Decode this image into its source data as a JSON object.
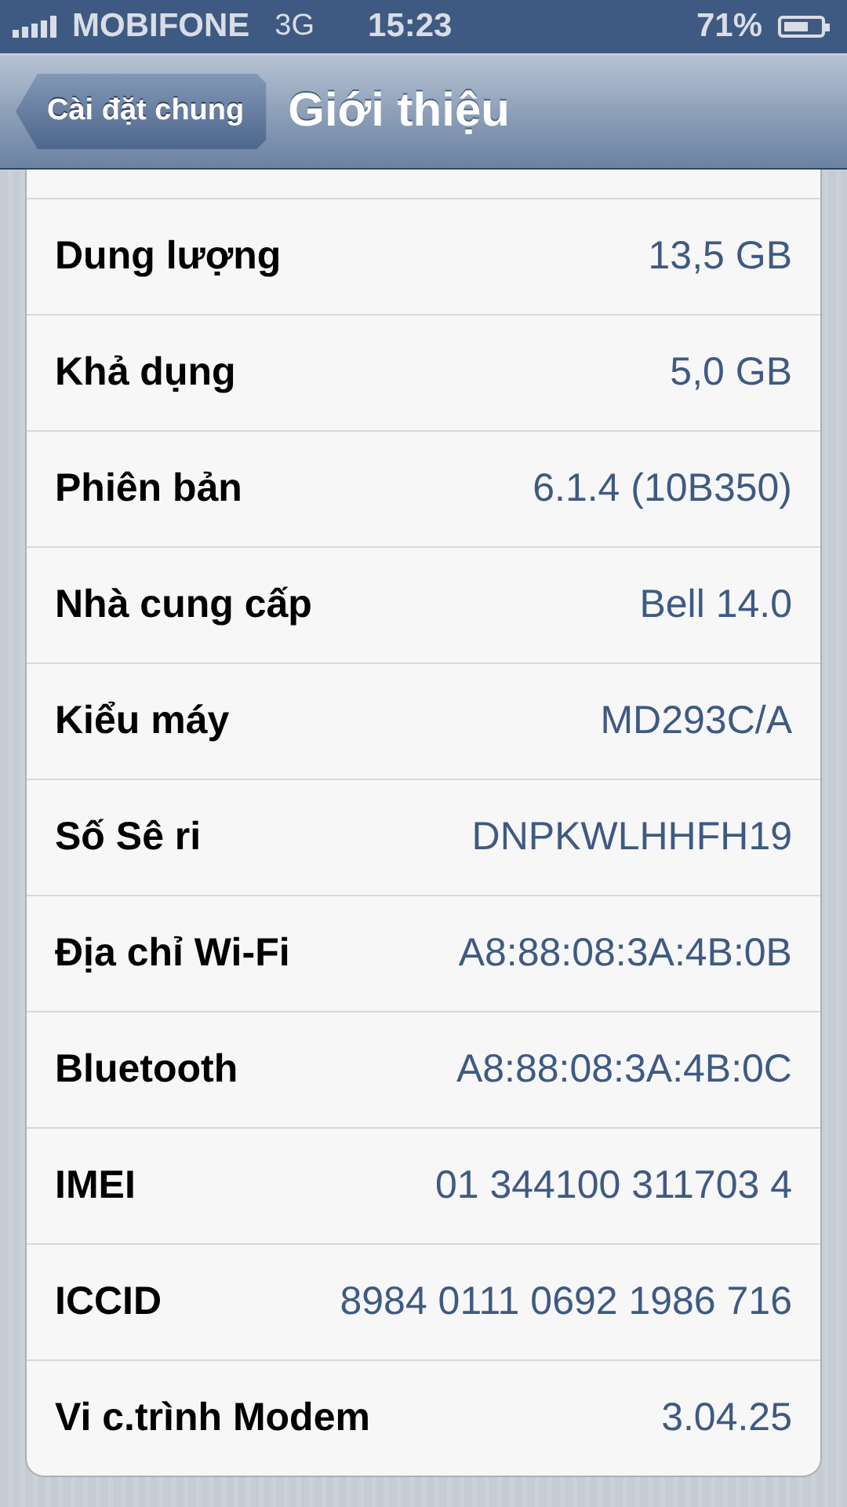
{
  "status_bar": {
    "carrier": "MOBIFONE",
    "network": "3G",
    "time": "15:23",
    "battery": "71%"
  },
  "nav_bar": {
    "back": "Cài đặt chung",
    "title": "Giới thiệu"
  },
  "rows": [
    {
      "label": "Dung lượng",
      "value": "13,5 GB"
    },
    {
      "label": "Khả dụng",
      "value": "5,0 GB"
    },
    {
      "label": "Phiên bản",
      "value": "6.1.4 (10B350)"
    },
    {
      "label": "Nhà cung cấp",
      "value": "Bell 14.0"
    },
    {
      "label": "Kiểu máy",
      "value": "MD293C/A"
    },
    {
      "label": "Số Sê ri",
      "value": "DNPKWLHHFH19"
    },
    {
      "label": "Địa chỉ Wi-Fi",
      "value": "A8:88:08:3A:4B:0B"
    },
    {
      "label": "Bluetooth",
      "value": "A8:88:08:3A:4B:0C"
    },
    {
      "label": "IMEI",
      "value": "01 344100 311703 4"
    },
    {
      "label": "ICCID",
      "value": "8984 0111 0692 1986 716"
    },
    {
      "label": "Vi c.trình Modem",
      "value": "3.04.25"
    }
  ]
}
